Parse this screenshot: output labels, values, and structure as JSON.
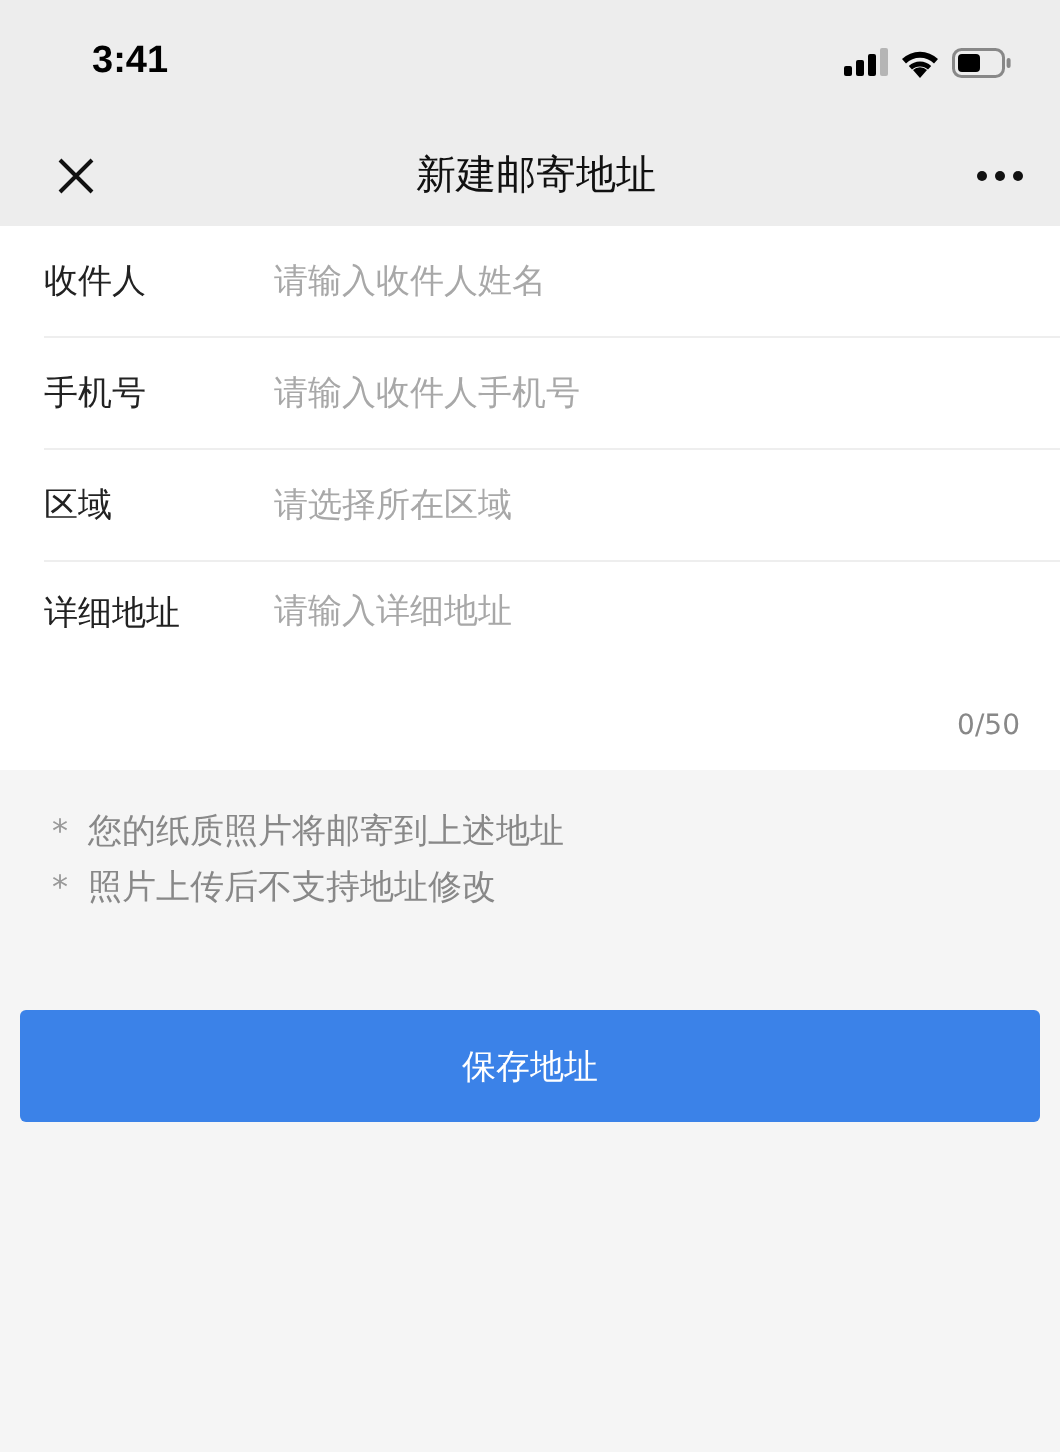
{
  "status_bar": {
    "time": "3:41"
  },
  "nav": {
    "title": "新建邮寄地址"
  },
  "fields": [
    {
      "kind": "text",
      "label": "收件人",
      "placeholder": "请输入收件人姓名"
    },
    {
      "kind": "text",
      "label": "手机号",
      "placeholder": "请输入收件人手机号"
    },
    {
      "kind": "text",
      "label": "区域",
      "placeholder": "请选择所在区域"
    },
    {
      "kind": "textarea",
      "label": "详细地址",
      "placeholder": "请输入详细地址",
      "counter": "0/50"
    }
  ],
  "notes": [
    {
      "mark": "*",
      "text": "您的纸质照片将邮寄到上述地址"
    },
    {
      "mark": "*",
      "text": "照片上传后不支持地址修改"
    }
  ],
  "button": "保存地址"
}
